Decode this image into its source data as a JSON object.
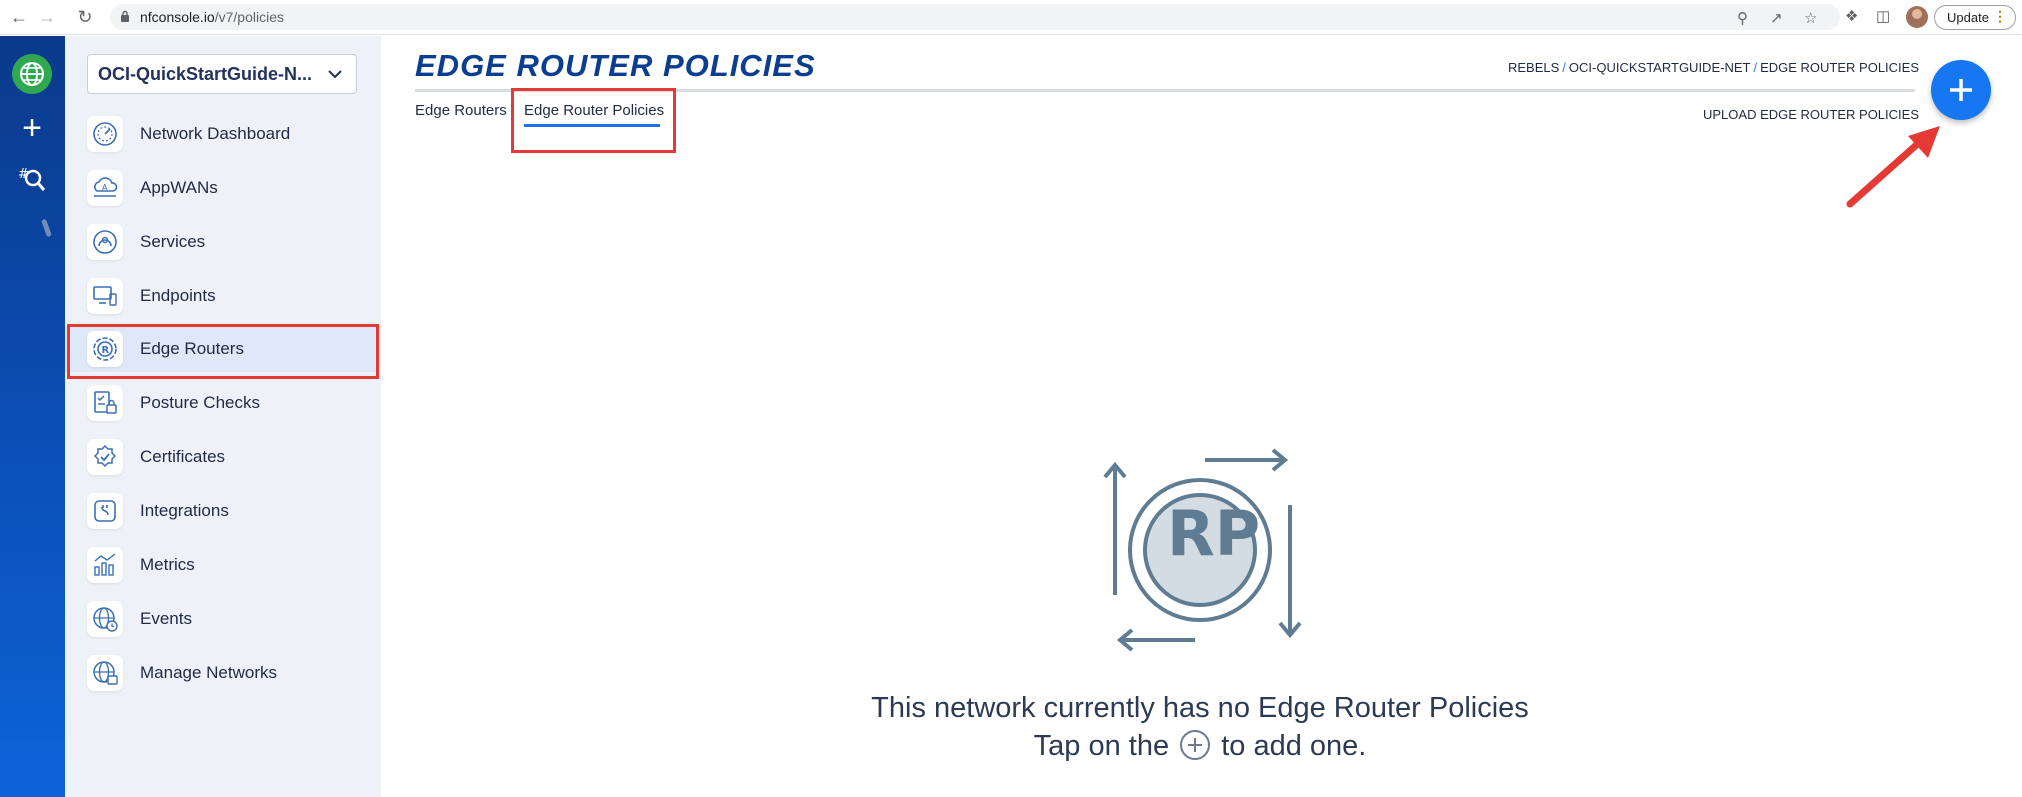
{
  "browser": {
    "url_host": "nfconsole.io",
    "url_path": "/v7/policies",
    "update_label": "Update"
  },
  "sidebar": {
    "network_selector": "OCI-QuickStartGuide-N...",
    "items": [
      {
        "label": "Network Dashboard",
        "icon": "dashboard-gauge-icon"
      },
      {
        "label": "AppWANs",
        "icon": "appwan-cloud-icon"
      },
      {
        "label": "Services",
        "icon": "services-icon"
      },
      {
        "label": "Endpoints",
        "icon": "endpoints-icon"
      },
      {
        "label": "Edge Routers",
        "icon": "edge-router-icon",
        "active": true
      },
      {
        "label": "Posture Checks",
        "icon": "posture-checks-icon"
      },
      {
        "label": "Certificates",
        "icon": "certificate-icon"
      },
      {
        "label": "Integrations",
        "icon": "integrations-icon"
      },
      {
        "label": "Metrics",
        "icon": "metrics-icon"
      },
      {
        "label": "Events",
        "icon": "events-icon"
      },
      {
        "label": "Manage Networks",
        "icon": "manage-networks-icon"
      }
    ]
  },
  "main": {
    "title": "EDGE ROUTER POLICIES",
    "breadcrumb": [
      "REBELS",
      "OCI-QUICKSTARTGUIDE-NET",
      "EDGE ROUTER POLICIES"
    ],
    "tabs": [
      {
        "label": "Edge Routers"
      },
      {
        "label": "Edge Router Policies",
        "active": true
      }
    ],
    "upload_link": "UPLOAD EDGE ROUTER POLICIES",
    "empty_state": {
      "line1": "This network currently has no Edge Router Policies",
      "line2_prefix": "Tap on the",
      "line2_suffix": "to add one.",
      "badge": "RP"
    }
  },
  "colors": {
    "brand_blue": "#0b3d91",
    "fab_blue": "#1677f0",
    "highlight_red": "#e53935",
    "rail_green": "#2fa84f"
  }
}
